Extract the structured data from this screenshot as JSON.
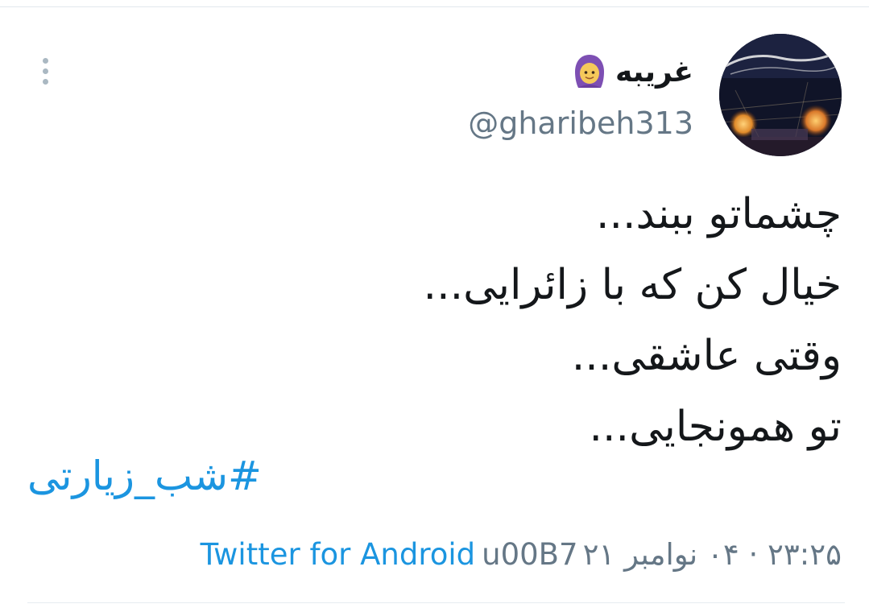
{
  "tweet": {
    "author": {
      "display_name": "غریبه",
      "name_emoji": "woman-with-headscarf-icon",
      "handle": "@gharibeh313"
    },
    "text_lines": [
      "چشماتو ببند...",
      "خیال کن که با زائرایی...",
      "وقتی عاشقی...",
      "تو همونجایی..."
    ],
    "hashtag": "#شب_زیارتی",
    "meta": {
      "date_time": "۲۳:۲۵ · ۰۴ نوامبر ۲۱",
      "separator": "u00B7",
      "source": "Twitter for Android"
    }
  },
  "colors": {
    "link": "#1b95e0",
    "muted": "#657786",
    "text": "#14171a",
    "divider": "#e1e8ed"
  }
}
